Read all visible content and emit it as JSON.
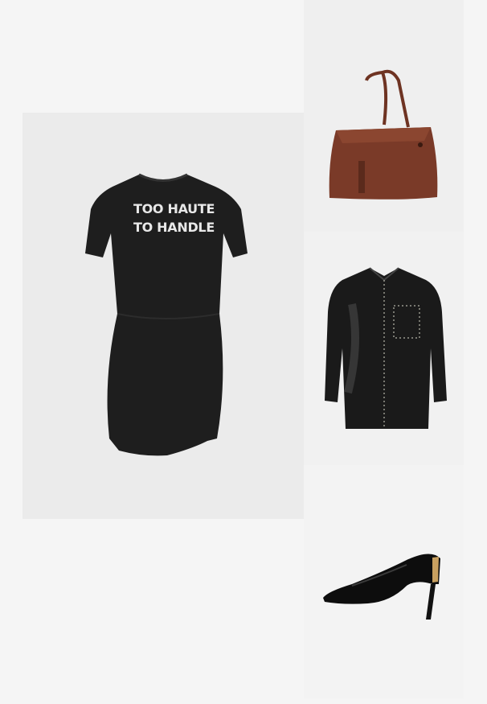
{
  "products": [
    {
      "id": "dress",
      "name": "black-tshirt-dress",
      "print": [
        "TOO HAUTE",
        "TO HANDLE"
      ],
      "color": "#1e1e1e"
    },
    {
      "id": "bag",
      "name": "brown-leather-tote",
      "color": "#7a3a28"
    },
    {
      "id": "shirt",
      "name": "black-patent-shirt",
      "color": "#1a1a1a"
    },
    {
      "id": "shoe",
      "name": "black-patent-pump",
      "color": "#0d0d0d"
    }
  ]
}
